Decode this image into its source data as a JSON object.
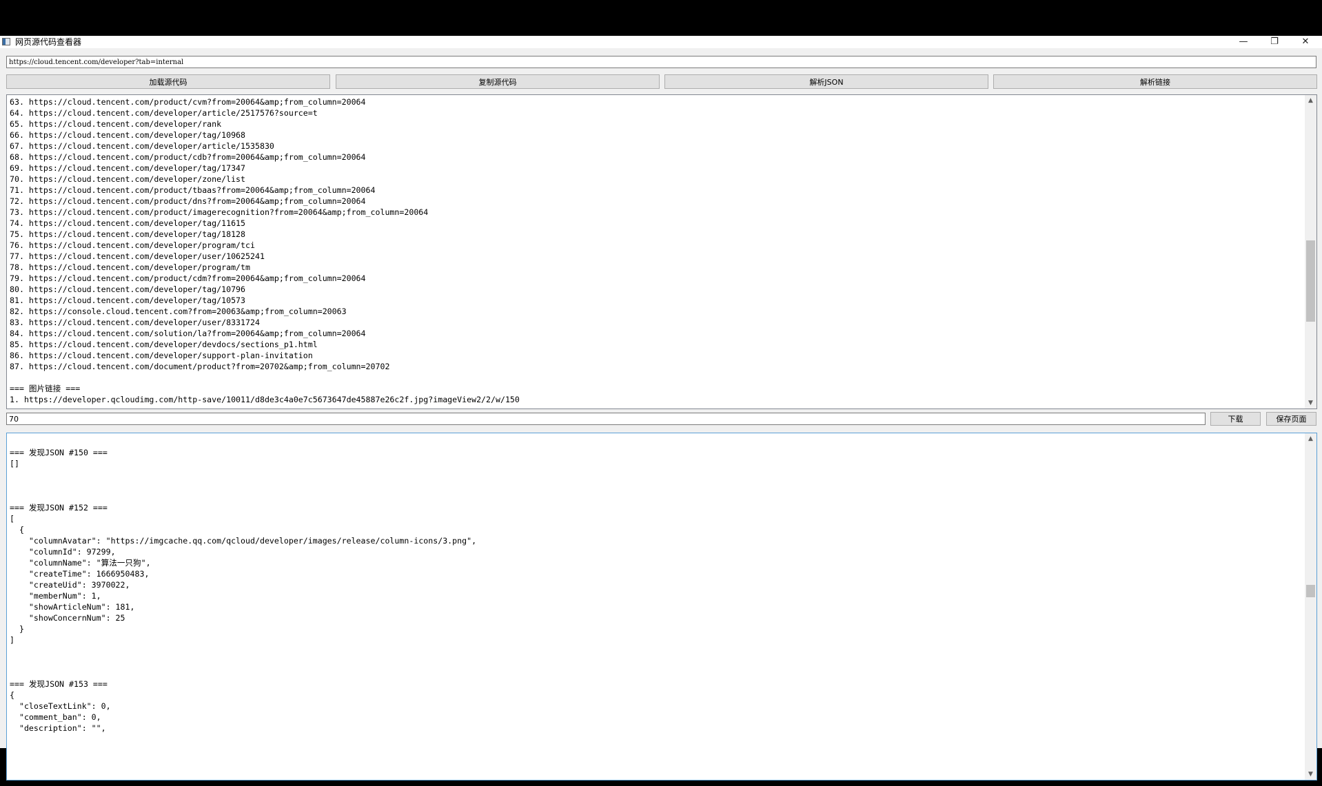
{
  "window": {
    "title": "网页源代码查看器",
    "controls": {
      "minimize": "—",
      "restore": "❐",
      "close": "✕"
    }
  },
  "url_input": {
    "value": "https://cloud.tencent.com/developer?tab=internal"
  },
  "toolbar": {
    "load_source": "加载源代码",
    "copy_source": "复制源代码",
    "parse_json": "解析JSON",
    "parse_links": "解析链接"
  },
  "links_output": {
    "lines": [
      "63. https://cloud.tencent.com/product/cvm?from=20064&amp;from_column=20064",
      "64. https://cloud.tencent.com/developer/article/2517576?source=t",
      "65. https://cloud.tencent.com/developer/rank",
      "66. https://cloud.tencent.com/developer/tag/10968",
      "67. https://cloud.tencent.com/developer/article/1535830",
      "68. https://cloud.tencent.com/product/cdb?from=20064&amp;from_column=20064",
      "69. https://cloud.tencent.com/developer/tag/17347",
      "70. https://cloud.tencent.com/developer/zone/list",
      "71. https://cloud.tencent.com/product/tbaas?from=20064&amp;from_column=20064",
      "72. https://cloud.tencent.com/product/dns?from=20064&amp;from_column=20064",
      "73. https://cloud.tencent.com/product/imagerecognition?from=20064&amp;from_column=20064",
      "74. https://cloud.tencent.com/developer/tag/11615",
      "75. https://cloud.tencent.com/developer/tag/18128",
      "76. https://cloud.tencent.com/developer/program/tci",
      "77. https://cloud.tencent.com/developer/user/10625241",
      "78. https://cloud.tencent.com/developer/program/tm",
      "79. https://cloud.tencent.com/product/cdm?from=20064&amp;from_column=20064",
      "80. https://cloud.tencent.com/developer/tag/10796",
      "81. https://cloud.tencent.com/developer/tag/10573",
      "82. https://console.cloud.tencent.com?from=20063&amp;from_column=20063",
      "83. https://cloud.tencent.com/developer/user/8331724",
      "84. https://cloud.tencent.com/solution/la?from=20064&amp;from_column=20064",
      "85. https://cloud.tencent.com/developer/devdocs/sections_p1.html",
      "86. https://cloud.tencent.com/developer/support-plan-invitation",
      "87. https://cloud.tencent.com/document/product?from=20702&amp;from_column=20702",
      "",
      "=== 图片链接 ===",
      "1. https://developer.qcloudimg.com/http-save/10011/d8de3c4a0e7c5673647de45887e26c2f.jpg?imageView2/2/w/150"
    ]
  },
  "filter_input": {
    "value": "70"
  },
  "actions": {
    "download": "下载",
    "save_page": "保存页面"
  },
  "json_output": {
    "lines": [
      "=== 发现JSON #150 ===",
      "[]",
      "",
      "",
      "",
      "=== 发现JSON #152 ===",
      "[",
      "  {",
      "    \"columnAvatar\": \"https://imgcache.qq.com/qcloud/developer/images/release/column-icons/3.png\",",
      "    \"columnId\": 97299,",
      "    \"columnName\": \"算法一只狗\",",
      "    \"createTime\": 1666950483,",
      "    \"createUid\": 3970022,",
      "    \"memberNum\": 1,",
      "    \"showArticleNum\": 181,",
      "    \"showConcernNum\": 25",
      "  }",
      "]",
      "",
      "",
      "",
      "=== 发现JSON #153 ===",
      "{",
      "  \"closeTextLink\": 0,",
      "  \"comment_ban\": 0,",
      "  \"description\": \"\","
    ]
  },
  "scrollbars": {
    "links_position": 0.64,
    "json_position": 0.45,
    "arrow_up": "▲",
    "arrow_down": "▼"
  }
}
